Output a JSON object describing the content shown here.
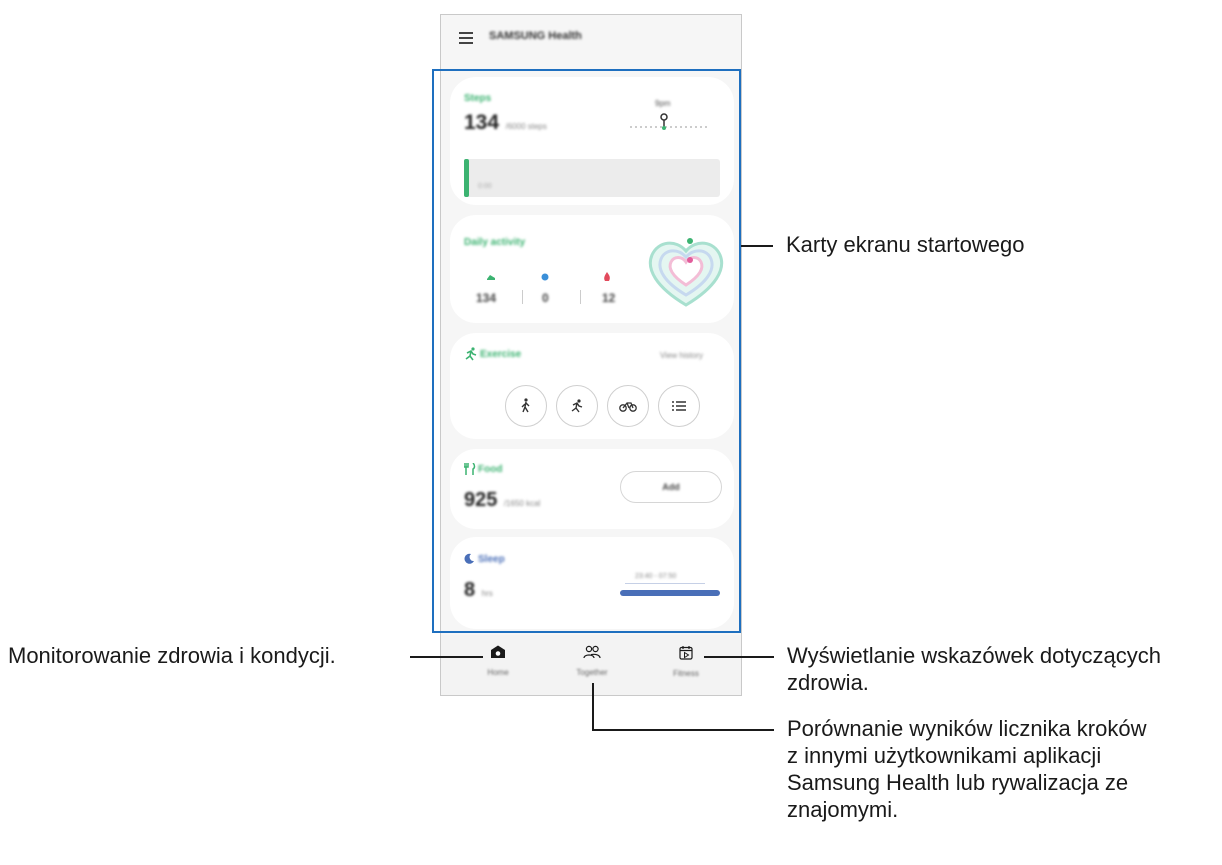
{
  "app": {
    "title": "SAMSUNG Health"
  },
  "cards": {
    "steps": {
      "label": "Steps",
      "value": "134",
      "unit": "/6000 steps",
      "time_label": "9pm",
      "bar_label": "0:00"
    },
    "daily_activity": {
      "label": "Daily activity",
      "steps": "134",
      "minutes": "0",
      "calories": "12"
    },
    "exercise": {
      "label": "Exercise",
      "link": "View history"
    },
    "food": {
      "label": "Food",
      "value": "925",
      "unit": "/1650 kcal",
      "button": "Add"
    },
    "sleep": {
      "label": "Sleep",
      "value": "8",
      "unit": "hrs",
      "range": "23:40 - 07:50"
    }
  },
  "nav": {
    "home": "Home",
    "together": "Together",
    "fitness": "Fitness"
  },
  "callouts": {
    "cards": "Karty ekranu startowego",
    "home": "Monitorowanie zdrowia i kondycji.",
    "fitness_line1": "Wyświetlanie wskazówek dotyczących",
    "fitness_line2": "zdrowia.",
    "together_line1": "Porównanie wyników licznika kroków",
    "together_line2": "z innymi użytkownikami aplikacji",
    "together_line3": "Samsung Health lub rywalizacja ze",
    "together_line4": "znajomymi."
  },
  "colors": {
    "accent_green": "#3cb371",
    "highlight_blue": "#1e6fbf",
    "sleep_blue": "#4a6fb8"
  }
}
